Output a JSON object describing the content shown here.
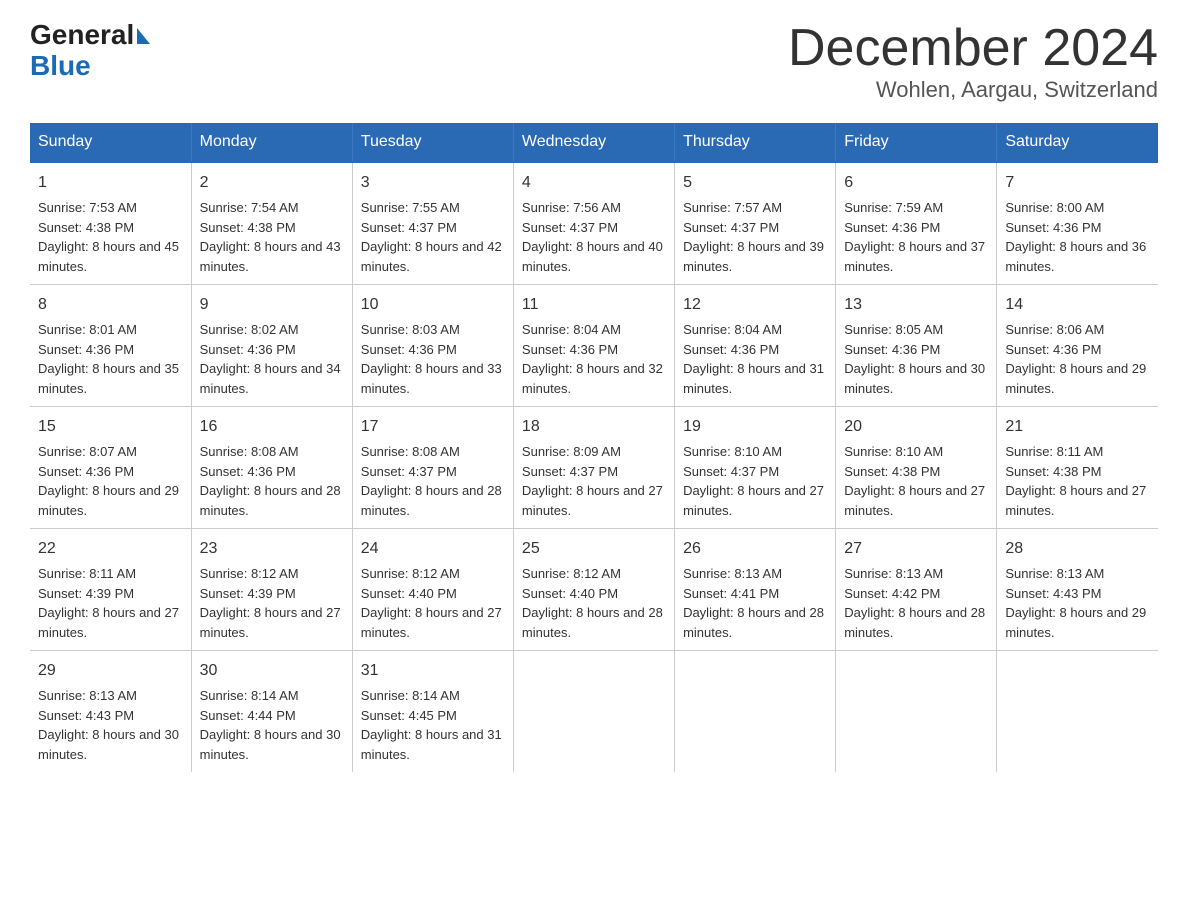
{
  "header": {
    "logo_line1": "General",
    "logo_line2": "Blue",
    "title": "December 2024",
    "subtitle": "Wohlen, Aargau, Switzerland"
  },
  "calendar": {
    "days_of_week": [
      "Sunday",
      "Monday",
      "Tuesday",
      "Wednesday",
      "Thursday",
      "Friday",
      "Saturday"
    ],
    "weeks": [
      [
        {
          "day": "1",
          "sunrise": "Sunrise: 7:53 AM",
          "sunset": "Sunset: 4:38 PM",
          "daylight": "Daylight: 8 hours and 45 minutes."
        },
        {
          "day": "2",
          "sunrise": "Sunrise: 7:54 AM",
          "sunset": "Sunset: 4:38 PM",
          "daylight": "Daylight: 8 hours and 43 minutes."
        },
        {
          "day": "3",
          "sunrise": "Sunrise: 7:55 AM",
          "sunset": "Sunset: 4:37 PM",
          "daylight": "Daylight: 8 hours and 42 minutes."
        },
        {
          "day": "4",
          "sunrise": "Sunrise: 7:56 AM",
          "sunset": "Sunset: 4:37 PM",
          "daylight": "Daylight: 8 hours and 40 minutes."
        },
        {
          "day": "5",
          "sunrise": "Sunrise: 7:57 AM",
          "sunset": "Sunset: 4:37 PM",
          "daylight": "Daylight: 8 hours and 39 minutes."
        },
        {
          "day": "6",
          "sunrise": "Sunrise: 7:59 AM",
          "sunset": "Sunset: 4:36 PM",
          "daylight": "Daylight: 8 hours and 37 minutes."
        },
        {
          "day": "7",
          "sunrise": "Sunrise: 8:00 AM",
          "sunset": "Sunset: 4:36 PM",
          "daylight": "Daylight: 8 hours and 36 minutes."
        }
      ],
      [
        {
          "day": "8",
          "sunrise": "Sunrise: 8:01 AM",
          "sunset": "Sunset: 4:36 PM",
          "daylight": "Daylight: 8 hours and 35 minutes."
        },
        {
          "day": "9",
          "sunrise": "Sunrise: 8:02 AM",
          "sunset": "Sunset: 4:36 PM",
          "daylight": "Daylight: 8 hours and 34 minutes."
        },
        {
          "day": "10",
          "sunrise": "Sunrise: 8:03 AM",
          "sunset": "Sunset: 4:36 PM",
          "daylight": "Daylight: 8 hours and 33 minutes."
        },
        {
          "day": "11",
          "sunrise": "Sunrise: 8:04 AM",
          "sunset": "Sunset: 4:36 PM",
          "daylight": "Daylight: 8 hours and 32 minutes."
        },
        {
          "day": "12",
          "sunrise": "Sunrise: 8:04 AM",
          "sunset": "Sunset: 4:36 PM",
          "daylight": "Daylight: 8 hours and 31 minutes."
        },
        {
          "day": "13",
          "sunrise": "Sunrise: 8:05 AM",
          "sunset": "Sunset: 4:36 PM",
          "daylight": "Daylight: 8 hours and 30 minutes."
        },
        {
          "day": "14",
          "sunrise": "Sunrise: 8:06 AM",
          "sunset": "Sunset: 4:36 PM",
          "daylight": "Daylight: 8 hours and 29 minutes."
        }
      ],
      [
        {
          "day": "15",
          "sunrise": "Sunrise: 8:07 AM",
          "sunset": "Sunset: 4:36 PM",
          "daylight": "Daylight: 8 hours and 29 minutes."
        },
        {
          "day": "16",
          "sunrise": "Sunrise: 8:08 AM",
          "sunset": "Sunset: 4:36 PM",
          "daylight": "Daylight: 8 hours and 28 minutes."
        },
        {
          "day": "17",
          "sunrise": "Sunrise: 8:08 AM",
          "sunset": "Sunset: 4:37 PM",
          "daylight": "Daylight: 8 hours and 28 minutes."
        },
        {
          "day": "18",
          "sunrise": "Sunrise: 8:09 AM",
          "sunset": "Sunset: 4:37 PM",
          "daylight": "Daylight: 8 hours and 27 minutes."
        },
        {
          "day": "19",
          "sunrise": "Sunrise: 8:10 AM",
          "sunset": "Sunset: 4:37 PM",
          "daylight": "Daylight: 8 hours and 27 minutes."
        },
        {
          "day": "20",
          "sunrise": "Sunrise: 8:10 AM",
          "sunset": "Sunset: 4:38 PM",
          "daylight": "Daylight: 8 hours and 27 minutes."
        },
        {
          "day": "21",
          "sunrise": "Sunrise: 8:11 AM",
          "sunset": "Sunset: 4:38 PM",
          "daylight": "Daylight: 8 hours and 27 minutes."
        }
      ],
      [
        {
          "day": "22",
          "sunrise": "Sunrise: 8:11 AM",
          "sunset": "Sunset: 4:39 PM",
          "daylight": "Daylight: 8 hours and 27 minutes."
        },
        {
          "day": "23",
          "sunrise": "Sunrise: 8:12 AM",
          "sunset": "Sunset: 4:39 PM",
          "daylight": "Daylight: 8 hours and 27 minutes."
        },
        {
          "day": "24",
          "sunrise": "Sunrise: 8:12 AM",
          "sunset": "Sunset: 4:40 PM",
          "daylight": "Daylight: 8 hours and 27 minutes."
        },
        {
          "day": "25",
          "sunrise": "Sunrise: 8:12 AM",
          "sunset": "Sunset: 4:40 PM",
          "daylight": "Daylight: 8 hours and 28 minutes."
        },
        {
          "day": "26",
          "sunrise": "Sunrise: 8:13 AM",
          "sunset": "Sunset: 4:41 PM",
          "daylight": "Daylight: 8 hours and 28 minutes."
        },
        {
          "day": "27",
          "sunrise": "Sunrise: 8:13 AM",
          "sunset": "Sunset: 4:42 PM",
          "daylight": "Daylight: 8 hours and 28 minutes."
        },
        {
          "day": "28",
          "sunrise": "Sunrise: 8:13 AM",
          "sunset": "Sunset: 4:43 PM",
          "daylight": "Daylight: 8 hours and 29 minutes."
        }
      ],
      [
        {
          "day": "29",
          "sunrise": "Sunrise: 8:13 AM",
          "sunset": "Sunset: 4:43 PM",
          "daylight": "Daylight: 8 hours and 30 minutes."
        },
        {
          "day": "30",
          "sunrise": "Sunrise: 8:14 AM",
          "sunset": "Sunset: 4:44 PM",
          "daylight": "Daylight: 8 hours and 30 minutes."
        },
        {
          "day": "31",
          "sunrise": "Sunrise: 8:14 AM",
          "sunset": "Sunset: 4:45 PM",
          "daylight": "Daylight: 8 hours and 31 minutes."
        },
        {
          "day": "",
          "sunrise": "",
          "sunset": "",
          "daylight": ""
        },
        {
          "day": "",
          "sunrise": "",
          "sunset": "",
          "daylight": ""
        },
        {
          "day": "",
          "sunrise": "",
          "sunset": "",
          "daylight": ""
        },
        {
          "day": "",
          "sunrise": "",
          "sunset": "",
          "daylight": ""
        }
      ]
    ]
  }
}
